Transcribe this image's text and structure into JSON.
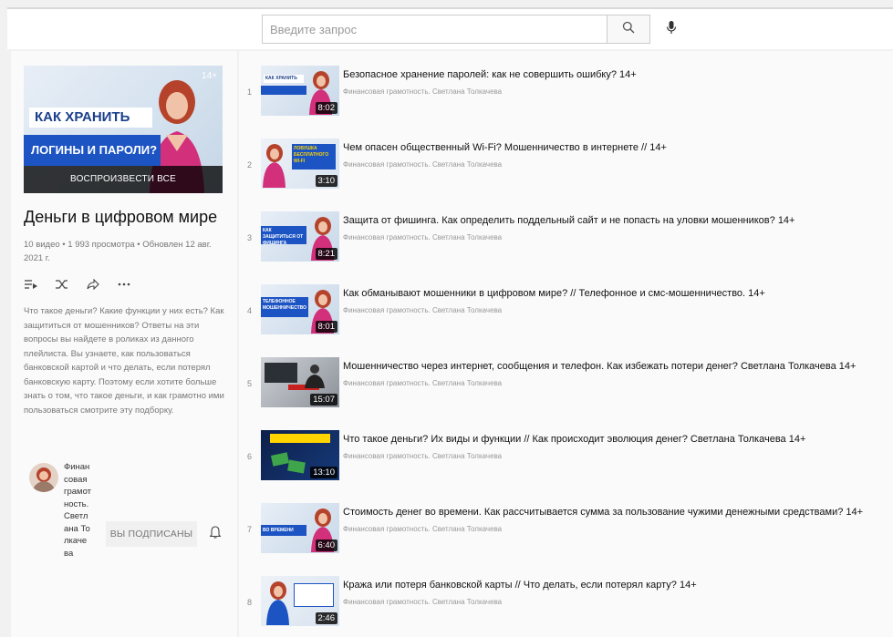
{
  "header": {
    "search_placeholder": "Введите запрос",
    "search_icon": "search-icon",
    "mic_icon": "microphone-icon"
  },
  "playlist": {
    "thumb_line1": "КАК ХРАНИТЬ",
    "thumb_line2": "ЛОГИНЫ И ПАРОЛИ?",
    "thumb_age": "14+",
    "play_all": "ВОСПРОИЗВЕСТИ ВСЕ",
    "title": "Деньги в цифровом мире",
    "stats": "10 видео • 1 993 просмотра • Обновлен 12 авг. 2021 г.",
    "description": "Что такое деньги? Какие функции у них есть? Как защититься от мошенников? Ответы на эти вопросы вы найдете в роликах из данного плейлиста. Вы узнаете, как пользоваться банковской картой и что делать, если потерял банковскую карту. Поэтому если хотите больше знать о том, что такое деньги, и как грамотно ими пользоваться смотрите эту подборку.",
    "owner_name": "Финансовая грамотность. Светлана Толкачева",
    "subscribed_label": "ВЫ ПОДПИСАНЫ"
  },
  "videos": [
    {
      "index": "1",
      "title": "Безопасное хранение паролей: как не совершить ошибку? 14+",
      "channel": "Финансовая грамотность. Светлана Толкачева",
      "duration": "8:02",
      "thumb_text": "КАК ХРАНИТЬ"
    },
    {
      "index": "2",
      "title": "Чем опасен общественный Wi-Fi? Мошенничество в интернете // 14+",
      "channel": "Финансовая грамотность. Светлана Толкачева",
      "duration": "3:10",
      "thumb_text": "ЛОВУШКА БЕСПЛАТНОГО WI-FI"
    },
    {
      "index": "3",
      "title": "Защита от фишинга. Как определить поддельный сайт и не попасть на уловки мошенников? 14+",
      "channel": "Финансовая грамотность. Светлана Толкачева",
      "duration": "8:21",
      "thumb_text": "КАК ЗАЩИТИТЬСЯ ОТ ФИШИНГА"
    },
    {
      "index": "4",
      "title": "Как обманывают мошенники в цифровом мире? // Телефонное и смс-мошенничество. 14+",
      "channel": "Финансовая грамотность. Светлана Толкачева",
      "duration": "8:01",
      "thumb_text": "ТЕЛЕФОННОЕ МОШЕННИЧЕСТВО"
    },
    {
      "index": "5",
      "title": "Мошенничество через интернет, сообщения и телефон. Как избежать потери денег? Светлана Толкачева 14+",
      "channel": "Финансовая грамотность. Светлана Толкачева",
      "duration": "15:07",
      "thumb_text": ""
    },
    {
      "index": "6",
      "title": "Что такое деньги? Их виды и функции // Как происходит эволюция денег? Светлана Толкачева 14+",
      "channel": "Финансовая грамотность. Светлана Толкачева",
      "duration": "13:10",
      "thumb_text": ""
    },
    {
      "index": "7",
      "title": "Стоимость денег во времени. Как рассчитывается сумма за пользование чужими денежными средствами? 14+",
      "channel": "Финансовая грамотность. Светлана Толкачева",
      "duration": "6:40",
      "thumb_text": "ВО ВРЕМЕНИ"
    },
    {
      "index": "8",
      "title": "Кража или потеря банковской карты // Что делать, если потерял карту? 14+",
      "channel": "Финансовая грамотность. Светлана Толкачева",
      "duration": "2:46",
      "thumb_text": ""
    }
  ],
  "colors": {
    "accent_blue": "#1d54c4",
    "pink": "#d2307a"
  }
}
